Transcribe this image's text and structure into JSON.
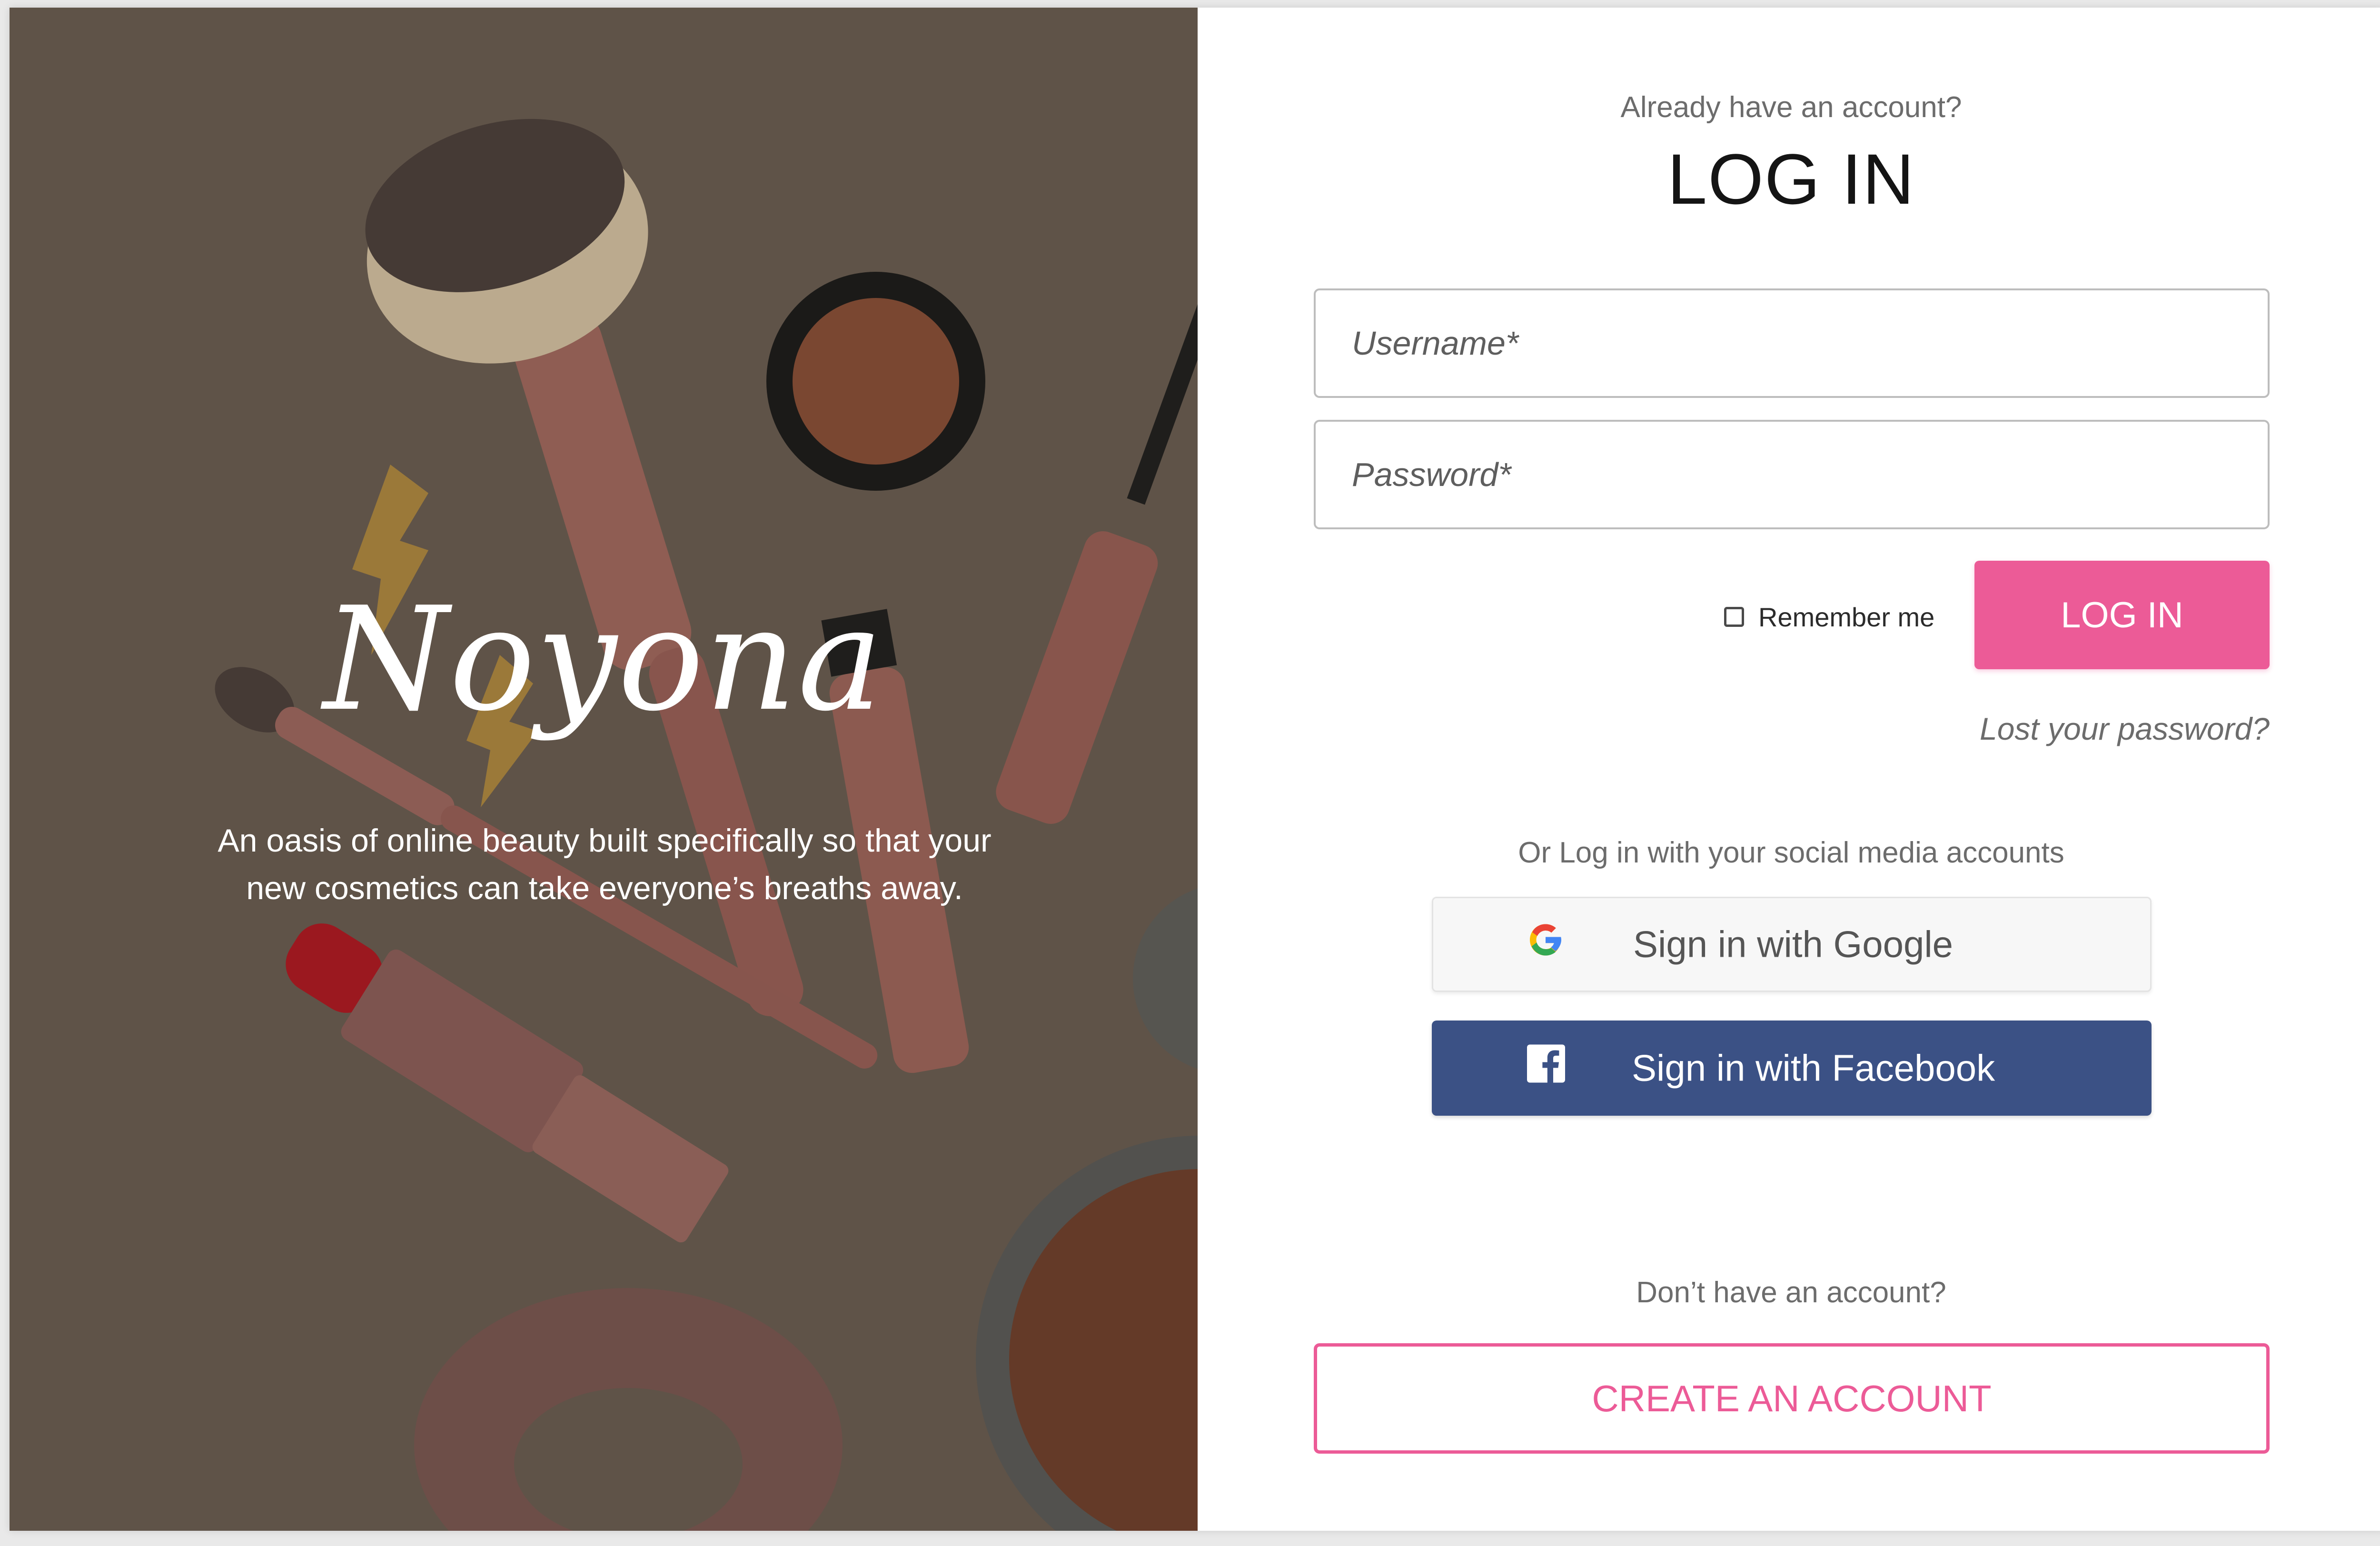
{
  "hero": {
    "brand": "Noyona",
    "tagline_line1": "An oasis of online beauty built specifically so that your",
    "tagline_line2": "new cosmetics can take everyone’s breaths away."
  },
  "login": {
    "already_text": "Already have an account?",
    "title": "LOG IN",
    "username_placeholder": "Username*",
    "password_placeholder": "Password*",
    "remember_label": "Remember me",
    "login_button": "LOG IN",
    "lost_password": "Lost your password?"
  },
  "social": {
    "heading": "Or Log in with your social media accounts",
    "google_label": "Sign in with Google",
    "facebook_label": "Sign in with Facebook"
  },
  "signup": {
    "prompt": "Don’t have an account?",
    "button": "CREATE AN ACCOUNT"
  },
  "colors": {
    "accent": "#ec5b97",
    "facebook": "#3b5185",
    "hero_bg": "#6a5d52"
  },
  "icons": [
    "google-icon",
    "facebook-icon"
  ]
}
